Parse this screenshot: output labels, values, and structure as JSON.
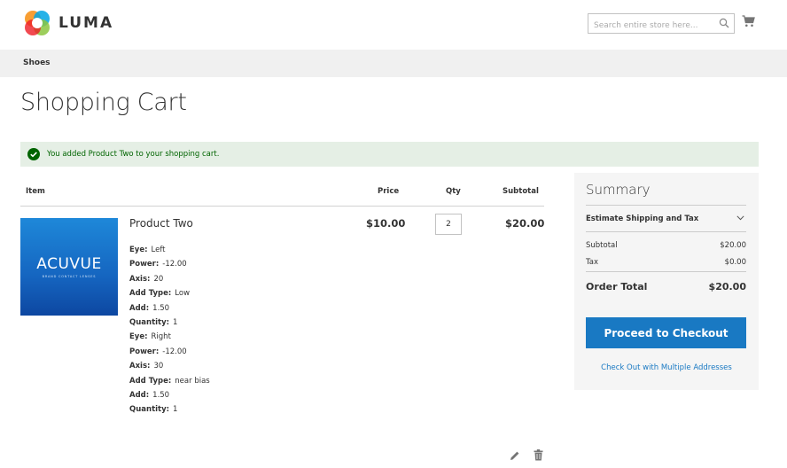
{
  "header": {
    "logo_text": "LUMA",
    "search_placeholder": "Search entire store here..."
  },
  "nav": {
    "item": "Shoes"
  },
  "page": {
    "title": "Shopping Cart"
  },
  "message": {
    "text": "You added Product Two to your shopping cart."
  },
  "cart": {
    "headers": {
      "item": "Item",
      "price": "Price",
      "qty": "Qty",
      "subtotal": "Subtotal"
    },
    "product": {
      "name": "Product Two",
      "image_brand": "ACUVUE",
      "image_sub": "BRAND CONTACT LENSES",
      "price": "$10.00",
      "qty": "2",
      "subtotal": "$20.00",
      "options": [
        {
          "label": "Eye:",
          "value": "Left"
        },
        {
          "label": "Power:",
          "value": "-12.00"
        },
        {
          "label": "Axis:",
          "value": "20"
        },
        {
          "label": "Add Type:",
          "value": "Low"
        },
        {
          "label": "Add:",
          "value": "1.50"
        },
        {
          "label": "Quantity:",
          "value": "1"
        },
        {
          "label": "Eye:",
          "value": "Right"
        },
        {
          "label": "Power:",
          "value": "-12.00"
        },
        {
          "label": "Axis:",
          "value": "30"
        },
        {
          "label": "Add Type:",
          "value": "near bias"
        },
        {
          "label": "Add:",
          "value": "1.50"
        },
        {
          "label": "Quantity:",
          "value": "1"
        }
      ]
    }
  },
  "summary": {
    "title": "Summary",
    "estimate_label": "Estimate Shipping and Tax",
    "subtotal_label": "Subtotal",
    "subtotal_value": "$20.00",
    "tax_label": "Tax",
    "tax_value": "$0.00",
    "order_total_label": "Order Total",
    "order_total_value": "$20.00",
    "checkout_label": "Proceed to Checkout",
    "multi_address_label": "Check Out with Multiple Addresses"
  },
  "colors": {
    "accent": "#1979c3",
    "success_bg": "#e5efe5",
    "success_text": "#006400"
  },
  "icons": {
    "logo": "luma-logo-icon",
    "search": "search-icon",
    "cart": "cart-icon",
    "success": "check-circle-icon",
    "chevron": "chevron-down-icon",
    "edit": "pencil-icon",
    "delete": "trash-icon"
  }
}
